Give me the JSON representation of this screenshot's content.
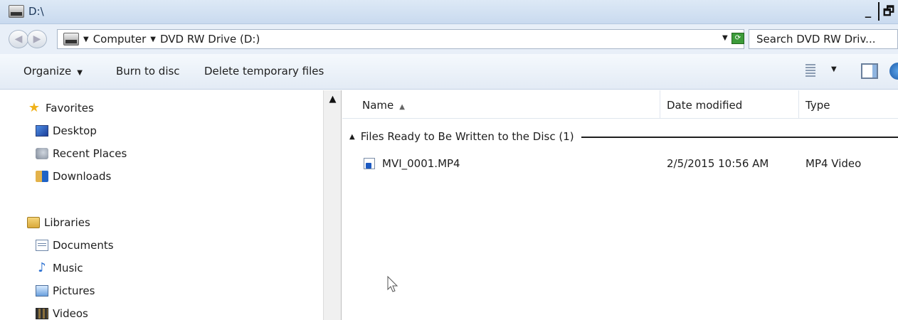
{
  "window": {
    "title": "D:\\"
  },
  "address": {
    "crumbs": [
      "Computer",
      "DVD RW Drive (D:)"
    ],
    "search_placeholder": "Search DVD RW Driv..."
  },
  "toolbar": {
    "organize": "Organize",
    "burn": "Burn to disc",
    "delete_temp": "Delete temporary files"
  },
  "nav": {
    "favorites": "Favorites",
    "desktop": "Desktop",
    "recent": "Recent Places",
    "downloads": "Downloads",
    "libraries": "Libraries",
    "documents": "Documents",
    "music": "Music",
    "pictures": "Pictures",
    "videos": "Videos"
  },
  "columns": {
    "name": "Name",
    "date": "Date modified",
    "type": "Type"
  },
  "group": {
    "label": "Files Ready to Be Written to the Disc (1)"
  },
  "files": [
    {
      "name": "MVI_0001.MP4",
      "date": "2/5/2015 10:56 AM",
      "type": "MP4 Video"
    }
  ]
}
